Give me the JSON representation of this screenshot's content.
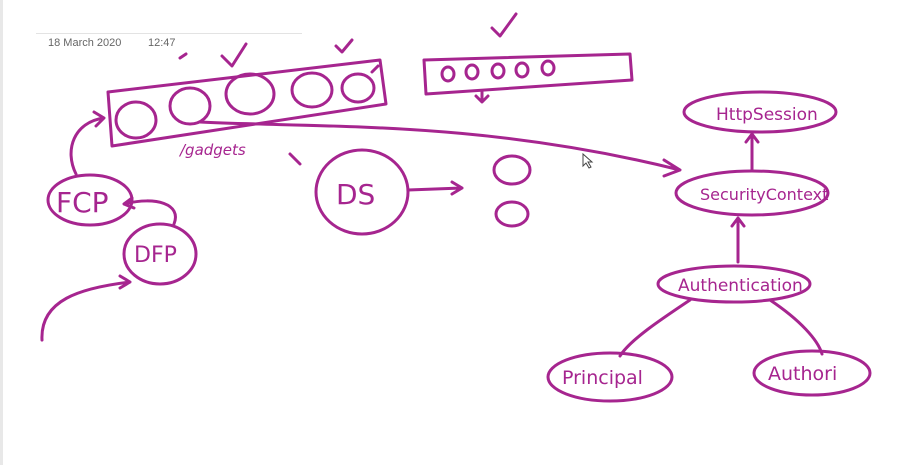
{
  "page": {
    "date": "18 March 2020",
    "time": "12:47"
  },
  "ink_color": "#a6258f",
  "drawing": {
    "labels": {
      "fcp": "FCP",
      "dfp": "DFP",
      "ds": "DS",
      "gadgets": "/gadgets",
      "http_session": "HttpSession",
      "security_context": "SecurityContext",
      "authentication": "Authentication",
      "principal": "Principal",
      "authorities": "Authori"
    }
  }
}
